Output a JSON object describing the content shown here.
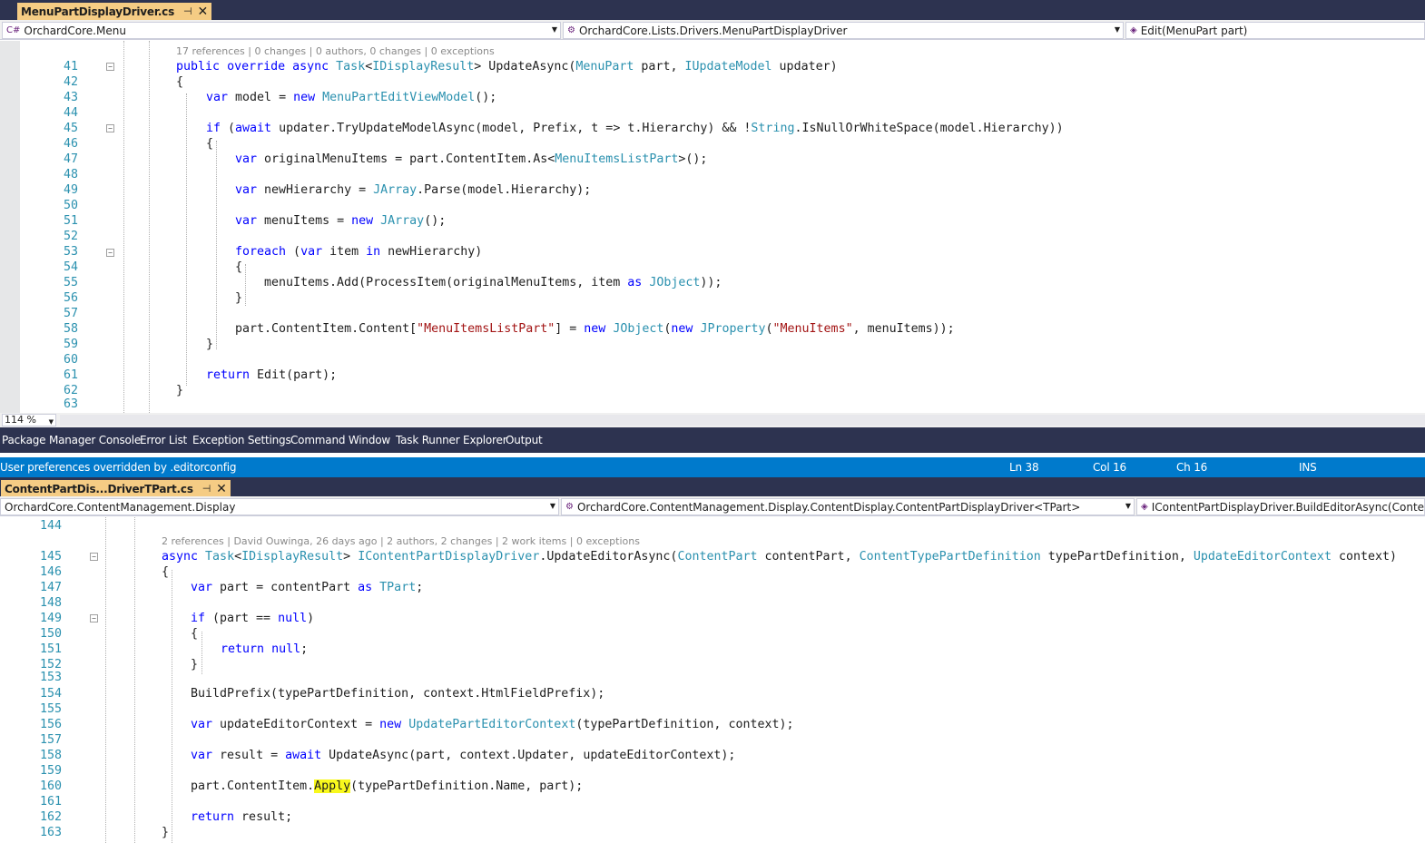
{
  "top_editor": {
    "tab": {
      "title": "MenuPartDisplayDriver.cs",
      "pin": "⊣",
      "close": "✕"
    },
    "nav": {
      "project": "OrchardCore.Menu",
      "type": "OrchardCore.Lists.Drivers.MenuPartDisplayDriver",
      "member": "Edit(MenuPart part)"
    },
    "codelens": "17 references | 0 changes | 0 authors, 0 changes | 0 exceptions",
    "zoom": "114 %",
    "line_numbers": [
      "41",
      "42",
      "43",
      "44",
      "45",
      "46",
      "47",
      "48",
      "49",
      "50",
      "51",
      "52",
      "53",
      "54",
      "55",
      "56",
      "57",
      "58",
      "59",
      "60",
      "61",
      "62",
      "63"
    ]
  },
  "tool_tabs": [
    "Package Manager Console",
    "Error List",
    "Exception Settings",
    "Command Window",
    "Task Runner Explorer",
    "Output"
  ],
  "status": {
    "message": "User preferences overridden by .editorconfig",
    "ln": "Ln 38",
    "col": "Col 16",
    "ch": "Ch 16",
    "mode": "INS"
  },
  "bottom_editor": {
    "tab": {
      "title": "ContentPartDis...DriverTPart.cs",
      "pin": "⊣",
      "close": "✕"
    },
    "nav": {
      "project": "OrchardCore.ContentManagement.Display",
      "type": "OrchardCore.ContentManagement.Display.ContentDisplay.ContentPartDisplayDriver<TPart>",
      "member": "IContentPartDisplayDriver.BuildEditorAsync(ContentPart"
    },
    "codelens": "2 references | David Ouwinga, 26 days ago | 2 authors, 2 changes | 2 work items | 0 exceptions",
    "line_numbers": [
      "144",
      "145",
      "146",
      "147",
      "148",
      "149",
      "150",
      "151",
      "152",
      "153",
      "154",
      "155",
      "156",
      "157",
      "158",
      "159",
      "160",
      "161",
      "162",
      "163"
    ]
  },
  "colors": {
    "tab_active": "#f5cc84",
    "frame": "#2d3350",
    "status": "#007acc",
    "keyword": "#0000ff",
    "type": "#2b91af",
    "string": "#a31515",
    "highlight": "#f8f81d"
  }
}
